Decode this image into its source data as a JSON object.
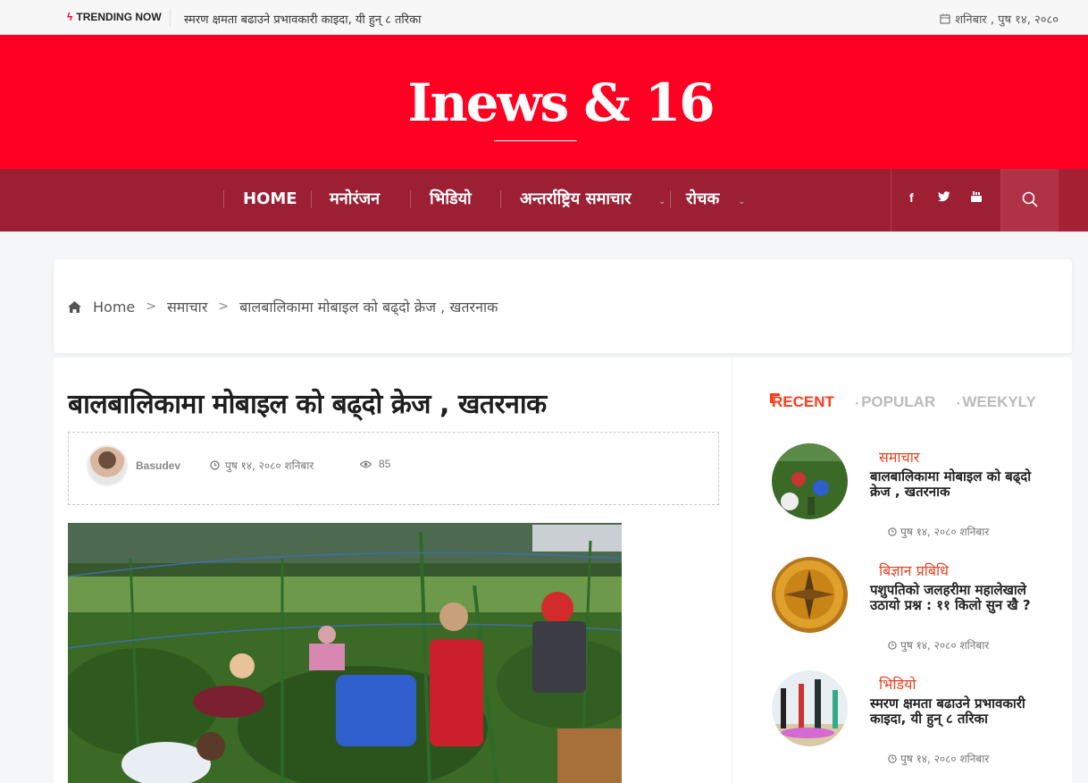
{
  "topbar": {
    "trending_label": "TRENDING NOW",
    "trending_text": "स्मरण क्षमता बढाउने प्रभावकारी काइदा, यी हुन् ८ तरिका",
    "date": "शनिबार , पुष १४, २०८०"
  },
  "header": {
    "logo": "Inews & 16"
  },
  "nav": {
    "items": [
      {
        "label": "HOME"
      },
      {
        "label": "मनोरंजन"
      },
      {
        "label": "भिडियो"
      },
      {
        "label": "अन्तर्राष्ट्रिय समाचार"
      },
      {
        "label": "रोचक"
      }
    ],
    "social": [
      "facebook-icon",
      "twitter-icon",
      "youtube-icon"
    ]
  },
  "breadcrumb": {
    "home": "Home",
    "category": "समाचार",
    "current": "बालबालिकामा मोबाइल को बढ्दो क्रेज , खतरनाक"
  },
  "article": {
    "title": "बालबालिकामा मोबाइल को बढ्दो क्रेज , खतरनाक",
    "author": "Basudev",
    "date": "पुष १४, २०८० शनिबार",
    "views": "85"
  },
  "sidebar": {
    "tabs": [
      {
        "label": "RECENT",
        "active": true
      },
      {
        "label": "POPULAR",
        "active": false
      },
      {
        "label": "WEEKYLY",
        "active": false
      }
    ],
    "posts": [
      {
        "category": "समाचार",
        "title": "बालबालिकामा मोबाइल को बढ्दो क्रेज , खतरनाक",
        "date": "पुष १४, २०८० शनिबार"
      },
      {
        "category": "बिज्ञान प्रबिधि",
        "title": "पशुपतिको जलहरीमा महालेखाले उठायो प्रश्न : ११ किलो सुन खै ?",
        "date": "पुष १४, २०८० शनिबार"
      },
      {
        "category": "भिडियो",
        "title": "स्मरण क्षमता बढाउने प्रभावकारी काइदा, यी हुन् ८ तरिका",
        "date": "पुष १४, २०८० शनिबार"
      }
    ]
  },
  "colors": {
    "brand_red": "#ff0022",
    "nav_bg": "#9c1f34",
    "accent_orange": "#e84423"
  }
}
